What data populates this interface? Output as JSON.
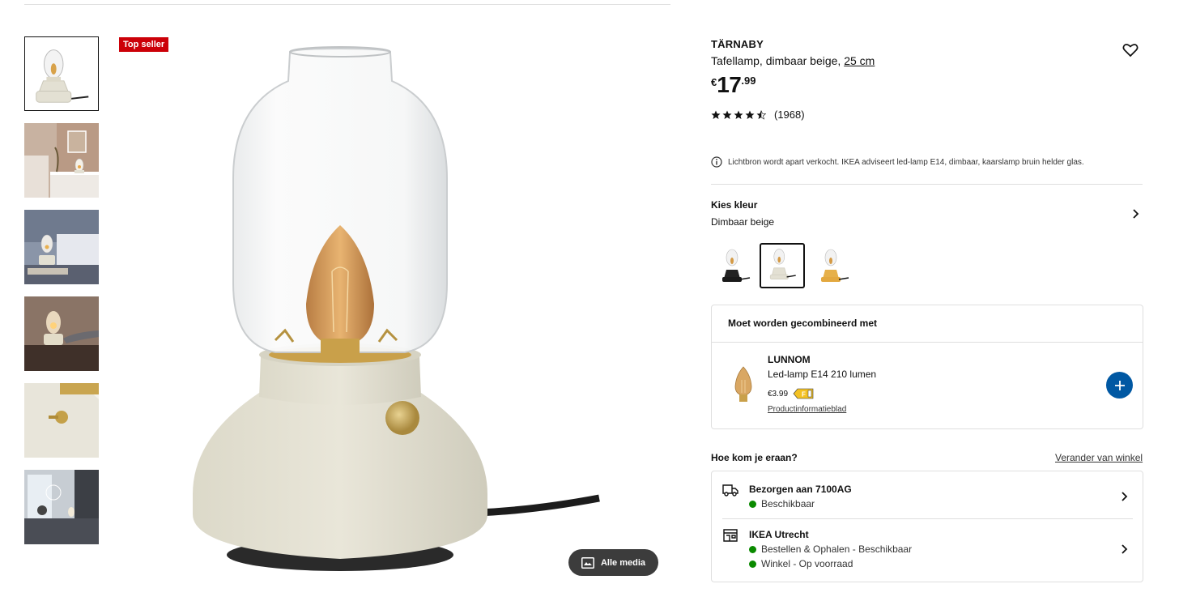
{
  "badge": "Top seller",
  "alle_media": "Alle media",
  "product": {
    "name": "TÄRNABY",
    "desc_prefix": "Tafellamp, dimbaar beige, ",
    "desc_size": "25 cm",
    "price_currency": "€",
    "price_int": "17",
    "price_dec": ".99",
    "rating_stars": 4.5,
    "review_count": "(1968)",
    "notice": "Lichtbron wordt apart verkocht. IKEA adviseert led-lamp E14, dimbaar, kaarslamp bruin helder glas."
  },
  "color": {
    "heading": "Kies kleur",
    "selected": "Dimbaar beige",
    "swatches": [
      "zwart",
      "beige",
      "geel"
    ]
  },
  "combine": {
    "heading": "Moet worden gecombineerd met",
    "name": "LUNNOM",
    "desc": "Led-lamp E14 210 lumen",
    "price": "€3.99",
    "energy_class": "F",
    "link": "Productinformatieblad"
  },
  "delivery": {
    "heading": "Hoe kom je eraan?",
    "change_store": "Verander van winkel",
    "ship_title": "Bezorgen aan 7100AG",
    "ship_status": "Beschikbaar",
    "store_title": "IKEA Utrecht",
    "store_status1": "Bestellen & Ophalen - Beschikbaar",
    "store_status2": "Winkel - Op voorraad"
  },
  "colors": {
    "badge": "#cc0008",
    "accent_blue": "#0058a3",
    "available_green": "#0a8a00"
  }
}
